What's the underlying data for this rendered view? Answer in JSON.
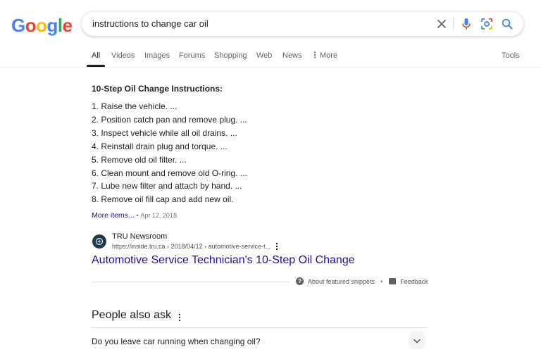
{
  "logo": {
    "letters": [
      "G",
      "o",
      "o",
      "g",
      "l",
      "e"
    ],
    "colors": [
      "#4285F4",
      "#EA4335",
      "#FBBC05",
      "#4285F4",
      "#34A853",
      "#EA4335"
    ]
  },
  "search": {
    "query": "instructions to change car oil"
  },
  "tabs": [
    {
      "label": "All",
      "active": true
    },
    {
      "label": "Videos"
    },
    {
      "label": "Images"
    },
    {
      "label": "Forums"
    },
    {
      "label": "Shopping"
    },
    {
      "label": "Web"
    },
    {
      "label": "News"
    },
    {
      "label": "More"
    }
  ],
  "tools_label": "Tools",
  "featured_snippet": {
    "title": "10-Step Oil Change Instructions:",
    "steps": [
      "1. Raise the vehicle. ...",
      "2. Position catch pan and remove plug. ...",
      "3. Inspect vehicle while all oil drains. ...",
      "4. Reinstall drain plug and torque. ...",
      "5. Remove old oil filter. ...",
      "6. Clean mount and remove old O-ring. ...",
      "7. Lube new filter and attach by hand. ...",
      "8. Remove oil fill cap and add new oil."
    ],
    "more_items": "More items...",
    "separator": "•",
    "date": "Apr 12, 2018",
    "source_name": "TRU Newsroom",
    "source_url": "https://inside.tru.ca › 2018/04/12 › automotive-service-t...",
    "result_title": "Automotive Service Technician's 10-Step Oil Change",
    "about_label": "About featured snippets",
    "footer_dot": "•",
    "feedback_label": "Feedback"
  },
  "people_also_ask": {
    "title": "People also ask",
    "questions": [
      "Do you leave car running when changing oil?"
    ]
  }
}
